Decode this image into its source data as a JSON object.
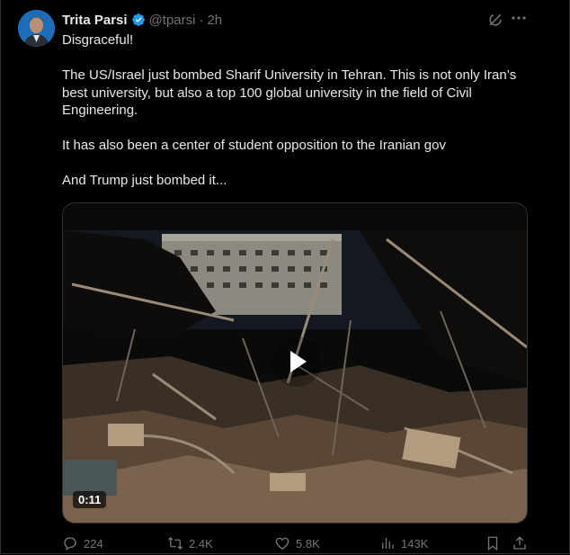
{
  "author": {
    "name": "Trita Parsi",
    "handle": "@tparsi",
    "time": "2h",
    "separator": "·",
    "verified": true
  },
  "tweet": {
    "paragraphs": [
      "Disgraceful!",
      "The US/Israel just bombed Sharif University in Tehran. This is not only Iran’s best university, but also a top 100 global university in the field of Civil Engineering.",
      "It has also been a center of student opposition to the Iranian gov",
      "And Trump just bombed it..."
    ]
  },
  "media": {
    "duration": "0:11",
    "type": "video"
  },
  "actions": {
    "replies": "224",
    "reposts": "2.4K",
    "likes": "5.8K",
    "views": "143K"
  },
  "icons": {
    "more": "more-options-icon",
    "grok": "grok-icon",
    "verified": "verified-badge-icon",
    "reply": "reply-icon",
    "repost": "repost-icon",
    "like": "heart-icon",
    "views": "analytics-icon",
    "bookmark": "bookmark-icon",
    "share": "share-icon",
    "play": "play-icon"
  },
  "colors": {
    "background": "#000000",
    "text": "#e7e9ea",
    "muted": "#71767b",
    "verified": "#1d9bf0",
    "border": "#2f3336"
  }
}
